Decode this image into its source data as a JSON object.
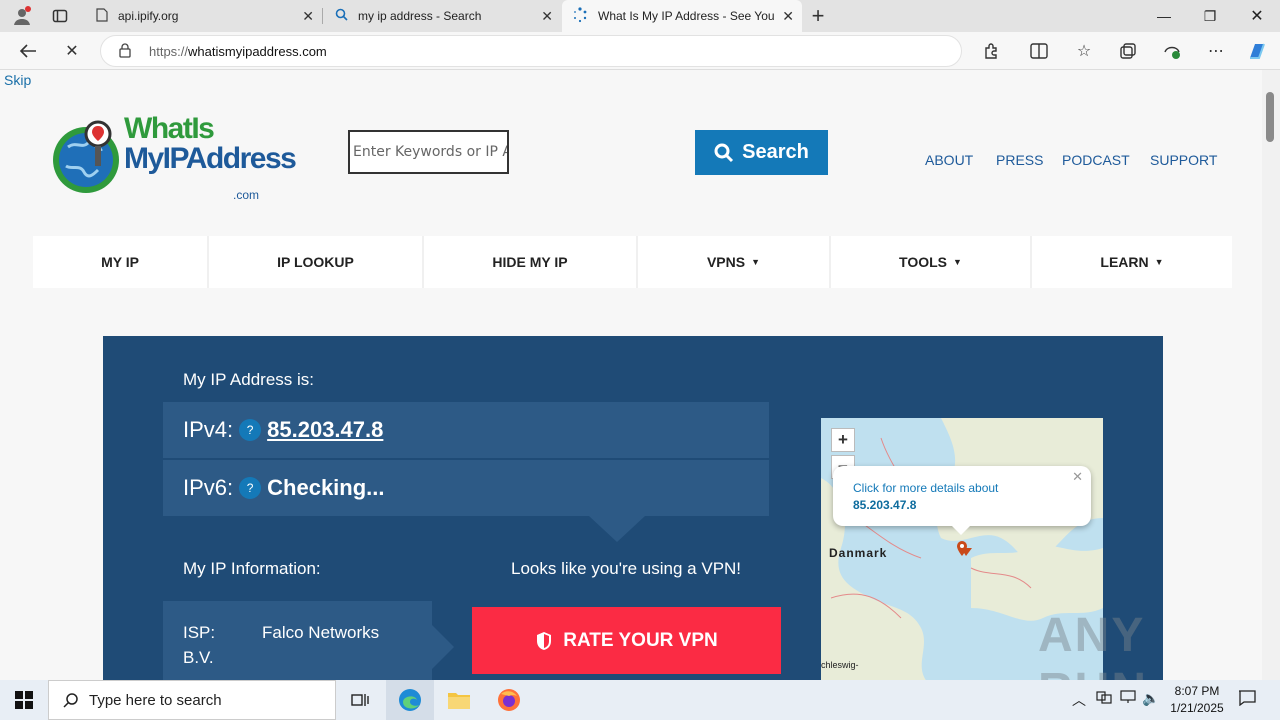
{
  "browser": {
    "tabs": [
      {
        "title": "api.ipify.org",
        "icon": "page-icon"
      },
      {
        "title": "my ip address - Search",
        "icon": "search-icon"
      },
      {
        "title": "What Is My IP Address - See Your",
        "icon": "loading-icon"
      }
    ],
    "url_scheme": "https://",
    "url_host": "whatismyipaddress.com"
  },
  "site": {
    "skip": "Skip",
    "logo": {
      "line1": "WhatIs",
      "line2": "MyIPAddress",
      "suffix": ".com"
    },
    "search": {
      "placeholder": "Enter Keywords or IP Address...",
      "button": "Search"
    },
    "toplinks": [
      "ABOUT",
      "PRESS",
      "PODCAST",
      "SUPPORT"
    ],
    "nav": [
      "MY IP",
      "IP LOOKUP",
      "HIDE MY IP",
      "VPNS",
      "TOOLS",
      "LEARN"
    ],
    "hero": {
      "title": "My IP Address is:",
      "ipv4_label": "IPv4:",
      "ipv4": "85.203.47.8",
      "ipv6_label": "IPv6:",
      "ipv6": "Checking...",
      "q": "?",
      "info_label": "My IP Information:",
      "vpn_notice": "Looks like you're using a VPN!",
      "isp_key": "ISP:",
      "isp_val": "Falco Networks",
      "isp_val2": "B.V.",
      "rate_btn": "RATE YOUR VPN"
    },
    "map": {
      "popup_text": "Click for more details about",
      "popup_ip": "85.203.47.8",
      "label_danmark": "Danmark",
      "label_schleswig": "chleswig-"
    }
  },
  "taskbar": {
    "search_placeholder": "Type here to search",
    "time": "8:07 PM",
    "date": "1/21/2025"
  },
  "watermark": "ANY RUN",
  "colors": {
    "hero": "#1f4b76",
    "row": "#2d5a86",
    "accent": "#1479b8",
    "rate": "#fb2b44"
  }
}
